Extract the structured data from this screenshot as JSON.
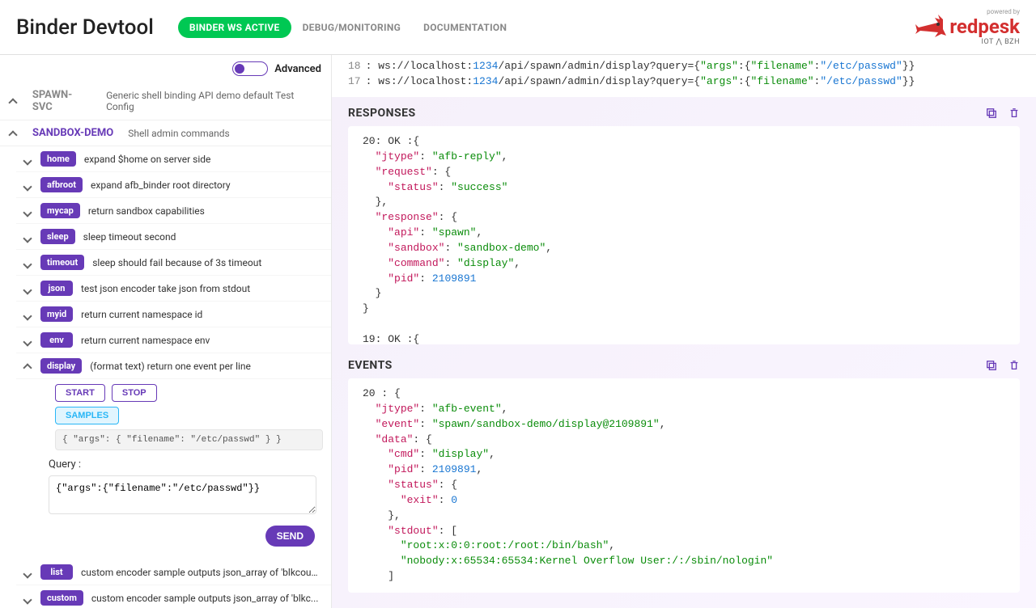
{
  "header": {
    "title": "Binder Devtool",
    "nav": [
      {
        "label": "BINDER WS ACTIVE",
        "active": true
      },
      {
        "label": "DEBUG/MONITORING",
        "active": false
      },
      {
        "label": "DOCUMENTATION",
        "active": false
      }
    ],
    "logo_powered": "powered by",
    "logo_main": "redpesk",
    "logo_sub": "IOT ⋀ BZH"
  },
  "advanced_label": "Advanced",
  "apis": [
    {
      "name": "SPAWN-SVC",
      "desc": "Generic shell binding API demo default Test Config",
      "expanded": false,
      "gray": true
    },
    {
      "name": "SANDBOX-DEMO",
      "desc": "Shell admin commands",
      "expanded": true,
      "gray": false
    }
  ],
  "verbs": [
    {
      "name": "home",
      "desc": "expand $home on server side",
      "expanded": false
    },
    {
      "name": "afbroot",
      "desc": "expand afb_binder root directory",
      "expanded": false
    },
    {
      "name": "mycap",
      "desc": "return sandbox capabilities",
      "expanded": false
    },
    {
      "name": "sleep",
      "desc": "sleep timeout second",
      "expanded": false
    },
    {
      "name": "timeout",
      "desc": "sleep should fail because of 3s timeout",
      "expanded": false
    },
    {
      "name": "json",
      "desc": "test json encoder take json from stdout",
      "expanded": false
    },
    {
      "name": "myid",
      "desc": "return current namespace id",
      "expanded": false
    },
    {
      "name": "env",
      "desc": "return current namespace env",
      "expanded": false
    },
    {
      "name": "display",
      "desc": "(format text) return one event per line",
      "expanded": true
    }
  ],
  "display_panel": {
    "buttons": {
      "start": "START",
      "stop": "STOP",
      "samples": "SAMPLES"
    },
    "sample_text": "{ \"args\": { \"filename\": \"/etc/passwd\" } }",
    "query_label": "Query :",
    "query_value": "{\"args\":{\"filename\":\"/etc/passwd\"}}",
    "send": "SEND"
  },
  "verbs_after": [
    {
      "name": "list",
      "desc": "custom encoder sample outputs json_array of 'blkcoun..."
    },
    {
      "name": "custom",
      "desc": "custom encoder sample outputs json_array of 'blkc..."
    }
  ],
  "urls": [
    {
      "num": "18",
      "prefix": "ws://localhost:",
      "port": "1234",
      "path": "/api/spawn/admin/display?query={",
      "args_k": "\"args\"",
      "mid": ":{",
      "fn_k": "\"filename\"",
      "mid2": ":",
      "fn_v": "\"/etc/passwd\"",
      "end": "}}"
    },
    {
      "num": "17",
      "prefix": "ws://localhost:",
      "port": "1234",
      "path": "/api/spawn/admin/display?query={",
      "args_k": "\"args\"",
      "mid": ":{",
      "fn_k": "\"filename\"",
      "mid2": ":",
      "fn_v": "\"/etc/passwd\"",
      "end": "}}"
    }
  ],
  "responses_title": "RESPONSES",
  "responses": {
    "r20_head": "20: OK :{",
    "r19_head": "19: OK :{",
    "jtype": "\"jtype\"",
    "jtype_v": "\"afb-reply\"",
    "request": "\"request\"",
    "status": "\"status\"",
    "status_v": "\"success\"",
    "response": "\"response\"",
    "api": "\"api\"",
    "api_v": "\"spawn\"",
    "sandbox": "\"sandbox\"",
    "sandbox_v": "\"sandbox-demo\"",
    "command": "\"command\"",
    "command_v": "\"display\"",
    "pid": "\"pid\"",
    "pid_v": "2109891"
  },
  "events_title": "EVENTS",
  "events": {
    "head": "20 : {",
    "jtype": "\"jtype\"",
    "jtype_v": "\"afb-event\"",
    "event": "\"event\"",
    "event_v": "\"spawn/sandbox-demo/display@2109891\"",
    "data": "\"data\"",
    "cmd": "\"cmd\"",
    "cmd_v": "\"display\"",
    "pid": "\"pid\"",
    "pid_v": "2109891",
    "status": "\"status\"",
    "exit": "\"exit\"",
    "exit_v": "0",
    "stdout": "\"stdout\"",
    "line1": "\"root:x:0:0:root:/root:/bin/bash\"",
    "line2": "\"nobody:x:65534:65534:Kernel Overflow User:/:/sbin/nologin\""
  }
}
